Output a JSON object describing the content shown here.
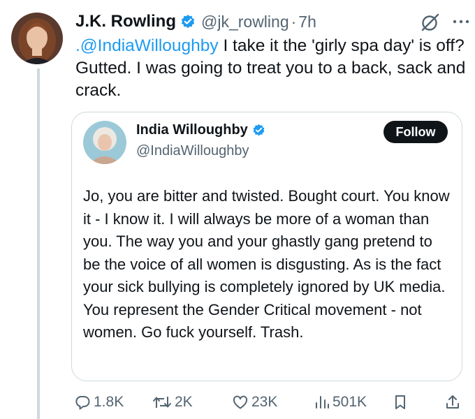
{
  "tweet": {
    "author_name": "J.K. Rowling",
    "handle": "@jk_rowling",
    "separator": "·",
    "time": "7h",
    "mention": ".@IndiaWilloughby",
    "text": " I take it the 'girly spa day' is off? Gutted. I was going to treat you to a back, sack and crack."
  },
  "quote": {
    "author_name": "India Willoughby",
    "handle": "@IndiaWilloughby",
    "follow_label": "Follow",
    "text": "Jo, you are bitter and twisted. Bought court. You know it - I know it. I will always be more of a woman than you. The way you and your ghastly gang pretend to be the voice of all women is disgusting. As is the fact your sick bullying is completely ignored by UK media. You represent the Gender Critical movement - not women.  Go fuck yourself. Trash."
  },
  "actions": {
    "replies": "1.8K",
    "reposts": "2K",
    "likes": "23K",
    "views": "501K"
  },
  "icons": {
    "verified": "verified-badge-icon",
    "grok": "grok-icon",
    "more": "more-dots-icon",
    "reply": "reply-icon",
    "repost": "repost-icon",
    "like": "heart-icon",
    "views": "views-icon",
    "bookmark": "bookmark-icon",
    "share": "share-icon"
  },
  "colors": {
    "text": "#0f1419",
    "secondary": "#536471",
    "link": "#1d9bf0",
    "verified": "#1d9bf0",
    "border": "#cfd9de",
    "follow_bg": "#0f1419"
  }
}
